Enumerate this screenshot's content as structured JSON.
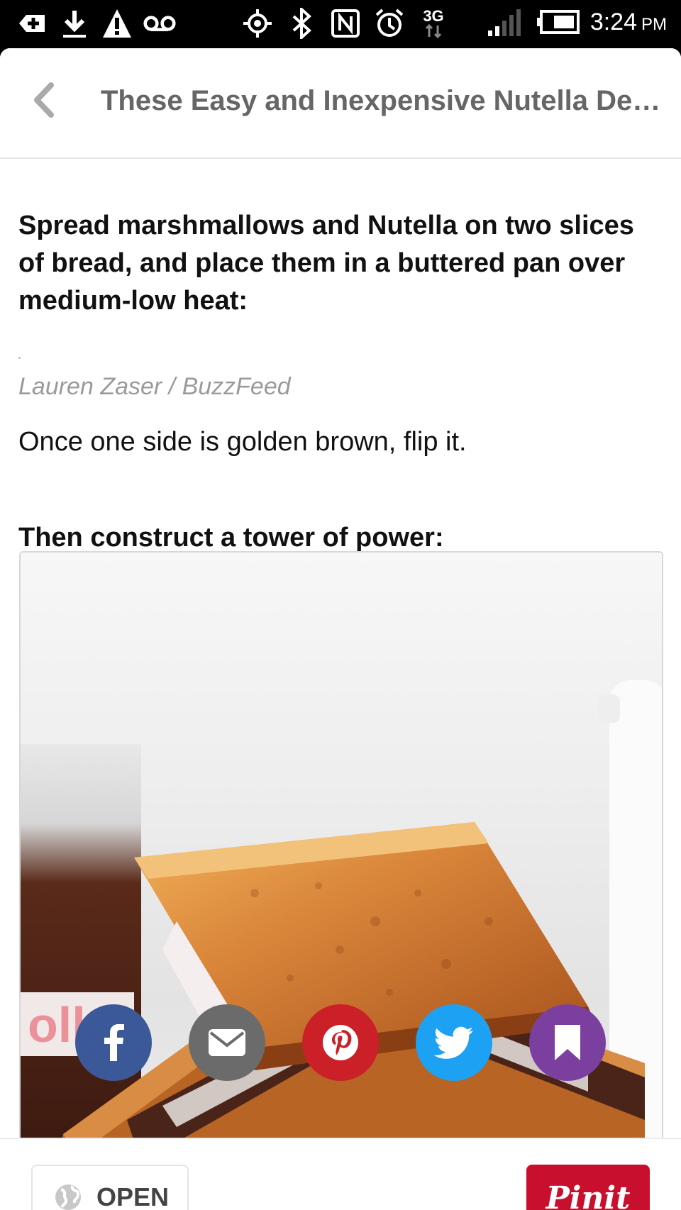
{
  "status_bar": {
    "time": "3:24",
    "ampm": "PM",
    "network": "3G",
    "icons": [
      "add-icon",
      "download-icon",
      "warning-icon",
      "voicemail-icon",
      "gps-icon",
      "bluetooth-icon",
      "nfc-icon",
      "alarm-icon",
      "signal-icon",
      "battery-icon"
    ]
  },
  "header": {
    "title": "These Easy and Inexpensive Nutella Des…"
  },
  "article": {
    "step1": "Spread marshmallows and Nutella on two slices of bread, and place them in a buttered pan over medium-low heat:",
    "credit": "Lauren Zaser / BuzzFeed",
    "step2_text": "Once one side is golden brown, flip it.",
    "step3": "Then construct a tower of power:"
  },
  "share": {
    "buttons": [
      {
        "name": "facebook",
        "color": "#3b5998"
      },
      {
        "name": "email",
        "color": "#6b6b6b"
      },
      {
        "name": "pinterest",
        "color": "#cb2027"
      },
      {
        "name": "twitter",
        "color": "#1da1f2"
      },
      {
        "name": "bookmark",
        "color": "#7b3fa0"
      }
    ]
  },
  "bottom_bar": {
    "open_label": "OPEN",
    "pinit_label": "Pinit"
  }
}
